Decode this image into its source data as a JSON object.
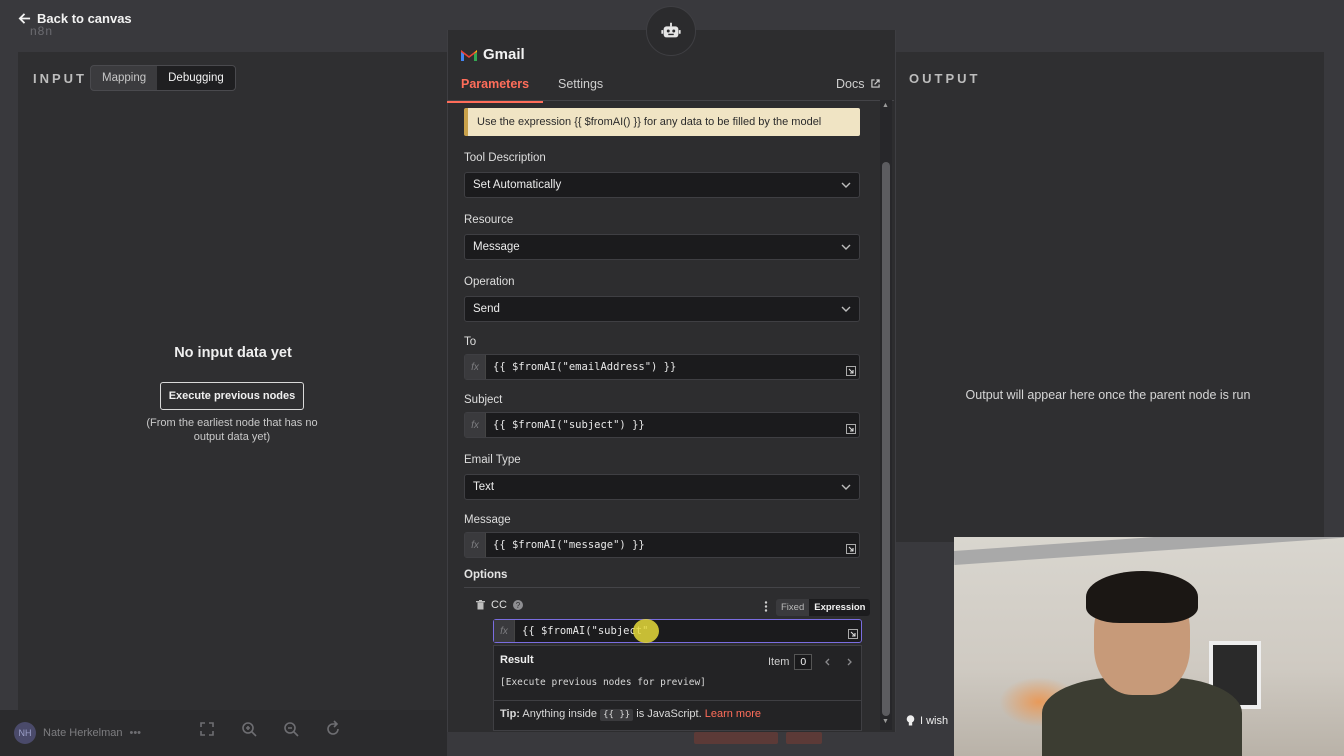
{
  "nav": {
    "back_label": "Back to canvas",
    "logo_text": "n8n"
  },
  "input_panel": {
    "title": "INPUT",
    "modes": [
      "Mapping",
      "Debugging"
    ],
    "active_mode": "Debugging",
    "empty_title": "No input data yet",
    "execute_button": "Execute previous nodes",
    "hint": "(From the earliest node that has no output data yet)"
  },
  "output_panel": {
    "title": "OUTPUT",
    "empty_message": "Output will appear here once the parent node is run"
  },
  "node": {
    "name": "Gmail",
    "tabs": {
      "parameters": "Parameters",
      "settings": "Settings",
      "docs": "Docs"
    },
    "notice": "Use the expression {{ $fromAI() }} for any data to be filled by the model",
    "fields": {
      "tool_description": {
        "label": "Tool Description",
        "value": "Set Automatically"
      },
      "resource": {
        "label": "Resource",
        "value": "Message"
      },
      "operation": {
        "label": "Operation",
        "value": "Send"
      },
      "to": {
        "label": "To",
        "value": "{{ $fromAI(\"emailAddress\") }}"
      },
      "subject": {
        "label": "Subject",
        "value": "{{ $fromAI(\"subject\") }}"
      },
      "email_type": {
        "label": "Email Type",
        "value": "Text"
      },
      "message": {
        "label": "Message",
        "value": "{{ $fromAI(\"message\") }}"
      }
    },
    "fx_label": "fx",
    "options": {
      "label": "Options",
      "cc": {
        "label": "CC",
        "mode_fixed": "Fixed",
        "mode_expression": "Expression",
        "value": "{{ $fromAI(\"subject\""
      }
    },
    "result": {
      "title": "Result",
      "item_label": "Item",
      "item_index": "0",
      "value": "[Execute previous nodes for preview]",
      "tip_prefix": "Tip:",
      "tip_text_1": "Anything inside",
      "tip_code": "{{ }}",
      "tip_text_2": "is JavaScript.",
      "tip_link": "Learn more"
    }
  },
  "footer": {
    "user_name": "Nate Herkelman",
    "user_initials": "NH",
    "feedback_text": "I wish"
  },
  "colors": {
    "accent": "#ff6d5a",
    "panel": "#2f2f31",
    "notice_bg": "#f0e4c4"
  }
}
